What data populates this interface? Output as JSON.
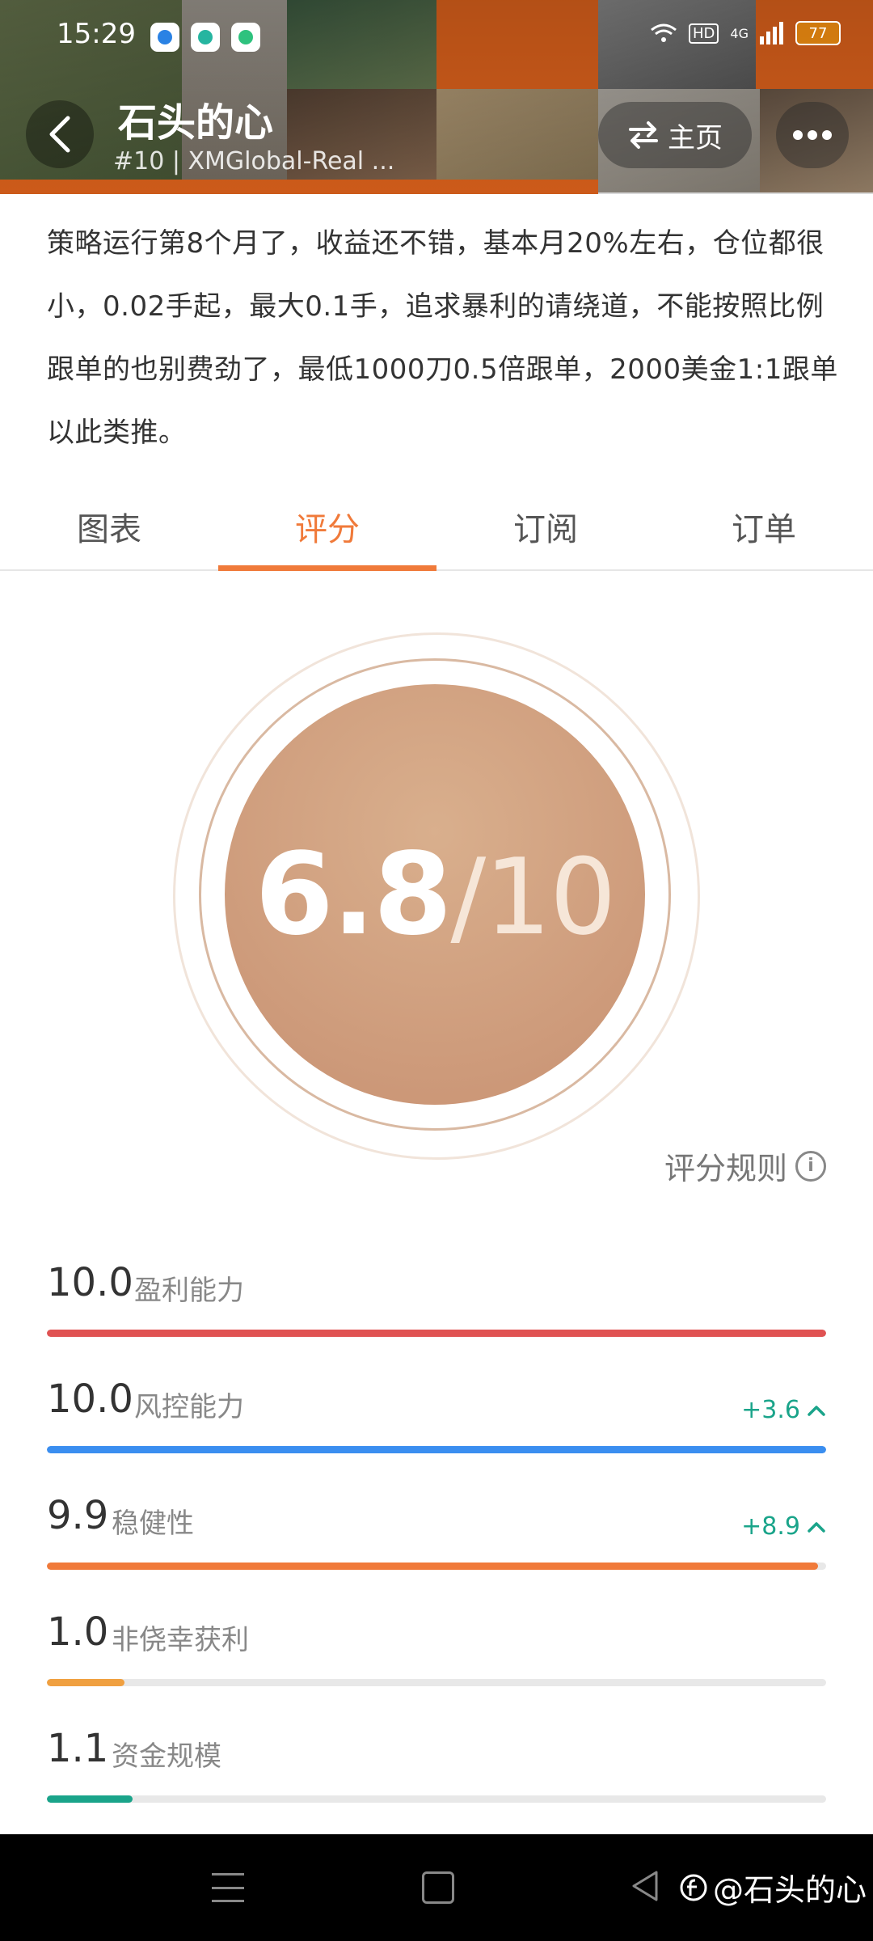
{
  "status_bar": {
    "time": "15:29",
    "network": "4G",
    "hd": "HD",
    "battery": "77"
  },
  "header": {
    "title": "石头的心",
    "subtitle": "#10 | XMGlobal-Real ...",
    "home_label": "主页",
    "accent": "#f06a1e"
  },
  "description": "策略运行第8个月了，收益还不错，基本月20%左右，仓位都很小，0.02手起，最大0.1手，追求暴利的请绕道，不能按照比例跟单的也别费劲了，最低1000刀0.5倍跟单，2000美金1:1跟单以此类推。",
  "tabs": [
    {
      "label": "图表",
      "active": false
    },
    {
      "label": "评分",
      "active": true
    },
    {
      "label": "订阅",
      "active": false
    },
    {
      "label": "订单",
      "active": false
    }
  ],
  "score": {
    "value": "6.8",
    "total": "/10"
  },
  "rules_label": "评分规则",
  "metrics": [
    {
      "value": "10.0",
      "label": "盈利能力",
      "delta": "",
      "fill": 1.0,
      "color": "#e05252"
    },
    {
      "value": "10.0",
      "label": "风控能力",
      "delta": "+3.6",
      "fill": 1.0,
      "color": "#3a8ef0"
    },
    {
      "value": "9.9",
      "label": "稳健性",
      "delta": "+8.9",
      "fill": 0.99,
      "color": "#f07a3a"
    },
    {
      "value": "1.0",
      "label": "非侥幸获利",
      "delta": "",
      "fill": 0.1,
      "color": "#f0a040"
    },
    {
      "value": "1.1",
      "label": "资金规模",
      "delta": "",
      "fill": 0.11,
      "color": "#1aa48a"
    }
  ],
  "watermark": "@石头的心"
}
